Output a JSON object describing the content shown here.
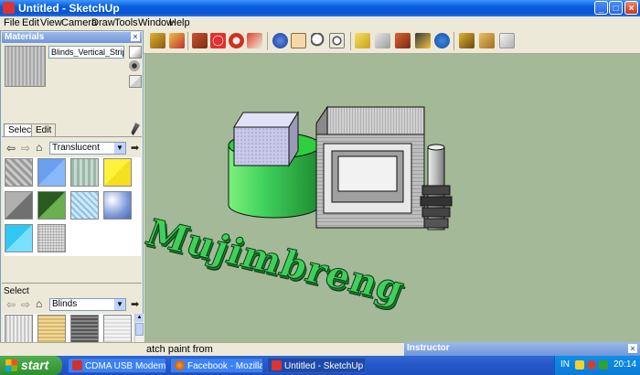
{
  "window": {
    "title": "Untitled - SketchUp"
  },
  "menu": [
    "File",
    "Edit",
    "View",
    "Camera",
    "Draw",
    "Tools",
    "Window",
    "Help"
  ],
  "materials": {
    "panel_title": "Materials",
    "current_material": "Blinds_Vertical_Stripe_G",
    "tabs": {
      "select": "Select",
      "edit": "Edit"
    },
    "library_top": "Translucent",
    "select_label": "Select",
    "library_bottom": "Blinds"
  },
  "viewport": {
    "text3d": "Mujimbreng"
  },
  "statusbar": {
    "text": "atch paint from"
  },
  "instructor": {
    "title": "Instructor"
  },
  "taskbar": {
    "start": "start",
    "tasks": [
      "CDMA USB Modem",
      "Facebook - Mozilla Fir...",
      "Untitled - SketchUp"
    ],
    "tray_lang": "IN",
    "clock": "20:14"
  },
  "colors": {
    "viewport_bg": "#a3b998",
    "text_green": "#3fd05c",
    "taskbar": "#245edb",
    "start_green": "#3c9a3c"
  }
}
